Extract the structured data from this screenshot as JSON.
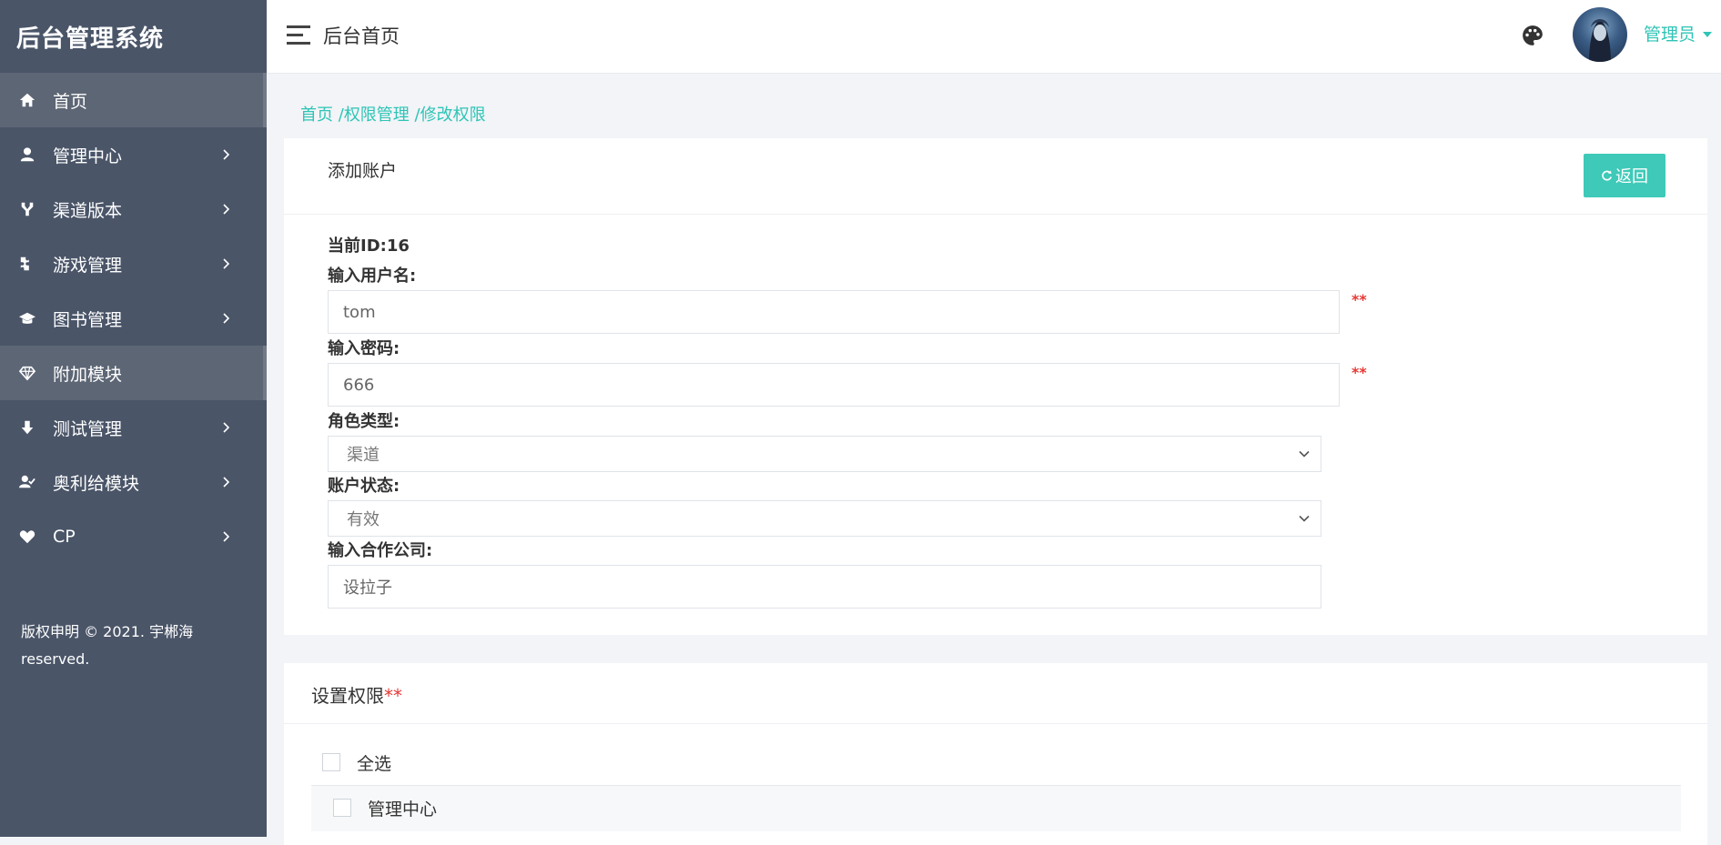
{
  "brand": "后台管理系统",
  "sidebar": {
    "items": [
      {
        "label": "首页",
        "icon": "home-icon",
        "active": true
      },
      {
        "label": "管理中心",
        "icon": "user-icon",
        "active": false
      },
      {
        "label": "渠道版本",
        "icon": "branch-icon",
        "active": false
      },
      {
        "label": "游戏管理",
        "icon": "puzzle-icon",
        "active": false
      },
      {
        "label": "图书管理",
        "icon": "graduation-cap-icon",
        "active": false
      },
      {
        "label": "附加模块",
        "icon": "diamond-icon",
        "active": true
      },
      {
        "label": "测试管理",
        "icon": "arrow-down-icon",
        "active": false
      },
      {
        "label": "奥利给模块",
        "icon": "user-check-icon",
        "active": false
      },
      {
        "label": "CP",
        "icon": "heart-icon",
        "active": false
      }
    ],
    "copyright": "版权申明 © 2021. 宇郴海 reserved."
  },
  "header": {
    "title": "后台首页",
    "user": "管理员"
  },
  "breadcrumb": {
    "home": "首页",
    "sep": "/",
    "section": "权限管理",
    "current": "修改权限"
  },
  "form": {
    "title": "添加账户",
    "back_label": "返回",
    "current_id": "当前ID:16",
    "username_label": "输入用户名:",
    "username_value": "tom",
    "password_label": "输入密码:",
    "password_value": "666",
    "role_label": "角色类型:",
    "role_value": "渠道",
    "status_label": "账户状态:",
    "status_value": "有效",
    "company_label": "输入合作公司:",
    "company_value": "设拉子",
    "required_mark": "**"
  },
  "permissions": {
    "title": "设置权限",
    "required_mark": "**",
    "select_all": "全选",
    "items": [
      "管理中心"
    ]
  },
  "colors": {
    "sidebar_bg": "#4a5568",
    "accent": "#2ec4b6",
    "button": "#3ec9b8",
    "required": "#e53935"
  }
}
